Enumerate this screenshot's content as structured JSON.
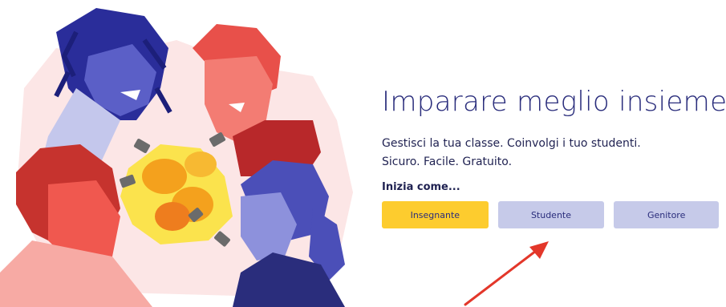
{
  "hero": {
    "title": "Imparare meglio insieme",
    "subtitle_line1": "Gestisci la tua classe. Coinvolgi i tuo studenti.",
    "subtitle_line2": "Sicuro. Facile. Gratuito.",
    "start_label": "Inizia come...",
    "roles": [
      {
        "label": "Insegnante"
      },
      {
        "label": "Studente"
      },
      {
        "label": "Genitore"
      }
    ]
  },
  "colors": {
    "title": "#2a2d7c",
    "text": "#1f2151",
    "teacher_button": "#fdcc2e",
    "role_button": "#c6cae9",
    "annotation_arrow": "#e3372a",
    "illustration_blue": "#3b3fa8",
    "illustration_red": "#f25a53",
    "illustration_pink_bg": "#fce6e6",
    "illustration_yellow": "#fbd21e",
    "illustration_orange": "#f4a11d"
  },
  "icons": {
    "illustration": "people-with-lightbulbs-illustration",
    "annotation": "red-arrow-icon"
  }
}
